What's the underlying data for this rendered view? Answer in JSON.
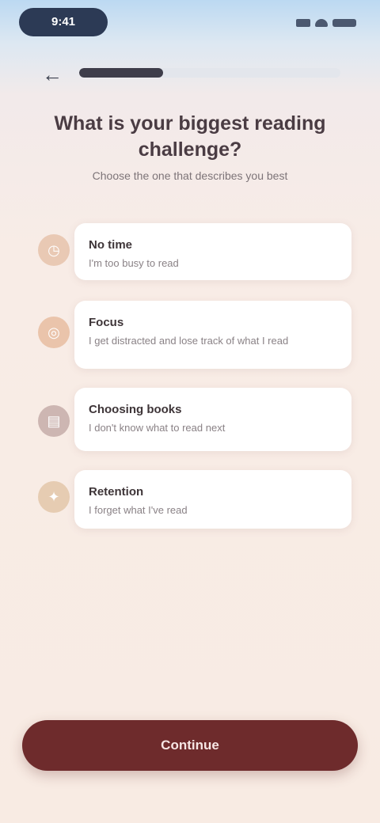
{
  "status_bar": {
    "time": "9:41"
  },
  "header": {
    "back_icon": "arrow-left-icon",
    "progress_fraction": 0.32
  },
  "title": "What is your biggest reading challenge?",
  "subtitle": "Choose the one that describes you best",
  "options": [
    {
      "icon": "clock-icon",
      "title": "No time",
      "description": "I'm too busy to read"
    },
    {
      "icon": "focus-icon",
      "title": "Focus",
      "description": "I get distracted and lose track of what I read"
    },
    {
      "icon": "book-icon",
      "title": "Choosing books",
      "description": "I don't know what to read next"
    },
    {
      "icon": "memory-icon",
      "title": "Retention",
      "description": "I forget what I've read"
    }
  ],
  "continue_label": "Continue",
  "colors": {
    "accent": "#6e2b2c",
    "background": "#f8ebe3",
    "progress": "#3e3d4a"
  }
}
